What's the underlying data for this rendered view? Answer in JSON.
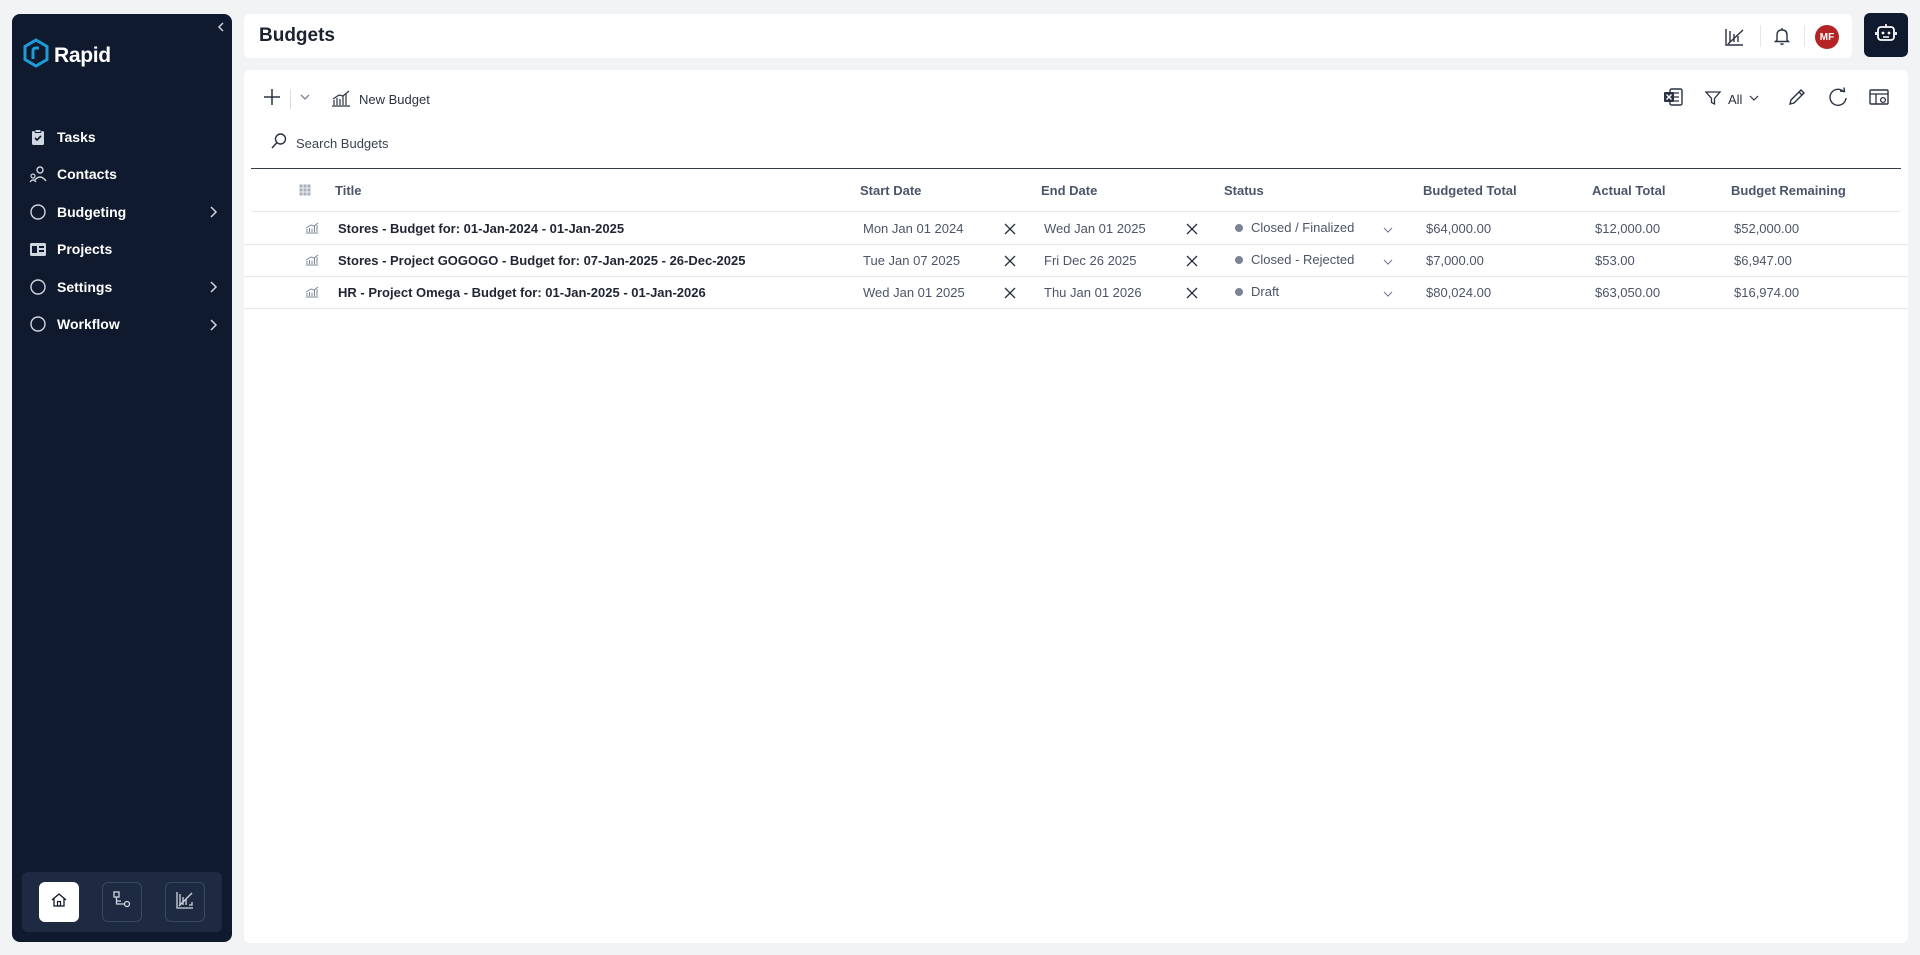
{
  "app": {
    "brand": "Rapid"
  },
  "sidebar": {
    "items": [
      {
        "label": "Tasks",
        "icon": "clipboard-check-icon",
        "has_children": false
      },
      {
        "label": "Contacts",
        "icon": "contacts-icon",
        "has_children": false
      },
      {
        "label": "Budgeting",
        "icon": "circle-icon",
        "has_children": true
      },
      {
        "label": "Projects",
        "icon": "projects-icon",
        "has_children": false
      },
      {
        "label": "Settings",
        "icon": "circle-icon",
        "has_children": true
      },
      {
        "label": "Workflow",
        "icon": "circle-icon",
        "has_children": true
      }
    ],
    "bottom": [
      "home-icon",
      "workflow-diagram-icon",
      "chart-icon"
    ],
    "bottom_active": "home-icon"
  },
  "header": {
    "title": "Budgets",
    "avatar_initials": "MF",
    "avatar_color": "#b42424"
  },
  "toolbar": {
    "new_budget_label": "New Budget",
    "filter_label": "All"
  },
  "search": {
    "placeholder": "Search Budgets"
  },
  "table": {
    "columns": {
      "title": "Title",
      "start_date": "Start Date",
      "end_date": "End Date",
      "status": "Status",
      "budgeted_total": "Budgeted Total",
      "actual_total": "Actual Total",
      "budget_remaining": "Budget Remaining"
    },
    "rows": [
      {
        "title": "Stores - Budget for: 01-Jan-2024 - 01-Jan-2025",
        "start_date": "Mon Jan 01 2024",
        "end_date": "Wed Jan 01 2025",
        "status": "Closed / Finalized",
        "budgeted_total": "$64,000.00",
        "actual_total": "$12,000.00",
        "budget_remaining": "$52,000.00"
      },
      {
        "title": "Stores - Project GOGOGO - Budget for: 07-Jan-2025 - 26-Dec-2025",
        "start_date": "Tue Jan 07 2025",
        "end_date": "Fri Dec 26 2025",
        "status": "Closed - Rejected",
        "budgeted_total": "$7,000.00",
        "actual_total": "$53.00",
        "budget_remaining": "$6,947.00"
      },
      {
        "title": "HR - Project Omega - Budget for: 01-Jan-2025 - 01-Jan-2026",
        "start_date": "Wed Jan 01 2025",
        "end_date": "Thu Jan 01 2026",
        "status": "Draft",
        "budgeted_total": "$80,024.00",
        "actual_total": "$63,050.00",
        "budget_remaining": "$16,974.00"
      }
    ]
  },
  "colors": {
    "sidebar_bg": "#0f1a2e",
    "accent": "#1e9bd7",
    "status_dot": "#7a8496"
  }
}
